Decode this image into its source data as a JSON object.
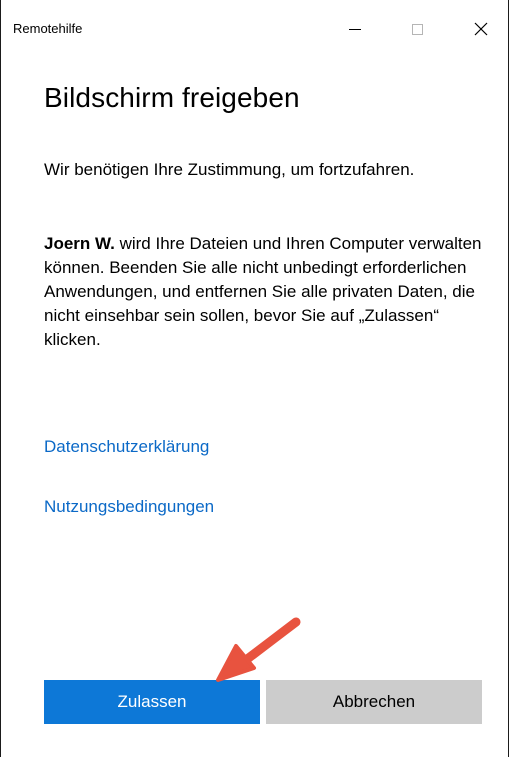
{
  "window": {
    "title": "Remotehilfe",
    "controls": {
      "minimize": "minimize-icon",
      "maximize": "maximize-icon",
      "close": "close-icon"
    }
  },
  "dialog": {
    "heading": "Bildschirm freigeben",
    "consent_text": "Wir benötigen Ihre Zustimmung, um fortzufahren.",
    "helper_name": "Joern W.",
    "info_text": " wird Ihre Dateien und Ihren Computer verwalten können. Beenden Sie alle nicht unbedingt erforderlichen Anwendungen, und entfernen Sie alle privaten Daten, die nicht einsehbar sein sollen, bevor Sie auf „Zulassen“ klicken.",
    "links": {
      "privacy": "Datenschutzerklärung",
      "terms": "Nutzungsbedingungen"
    },
    "buttons": {
      "allow": "Zulassen",
      "cancel": "Abbrechen"
    }
  },
  "colors": {
    "accent": "#0d78d7",
    "link": "#0b69c7",
    "secondary_button": "#cccccc",
    "annotation_arrow": "#e8533f"
  }
}
